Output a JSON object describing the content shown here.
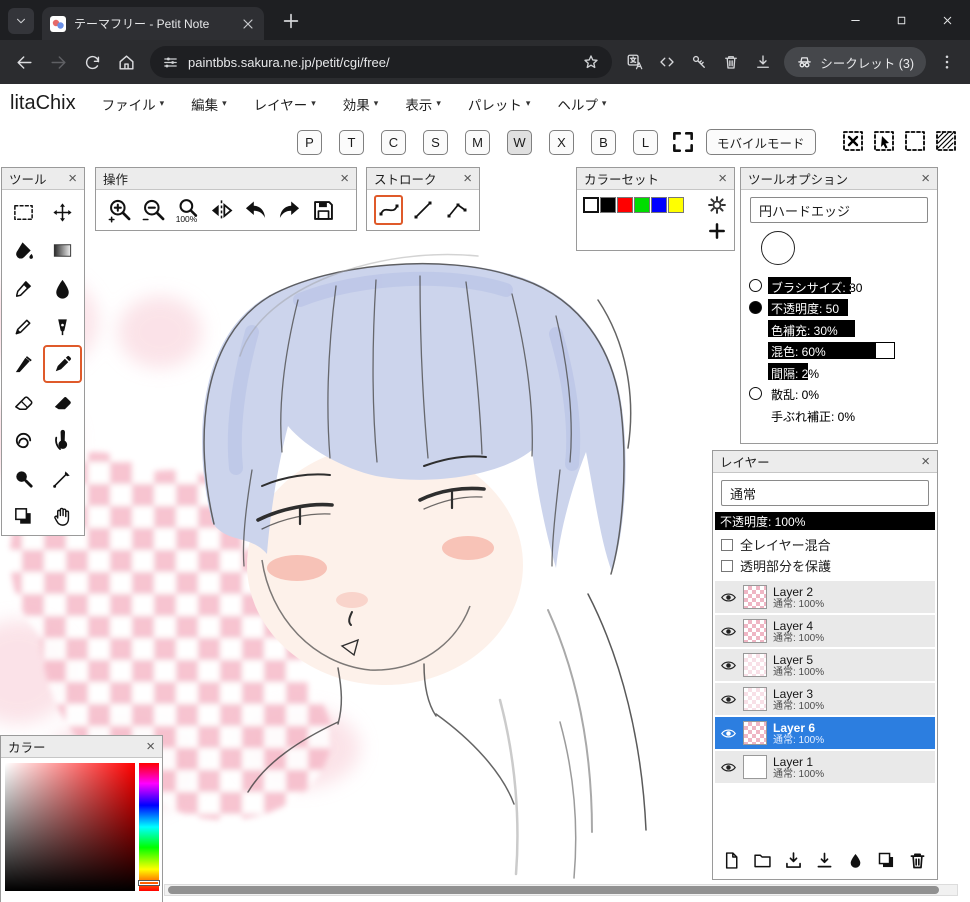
{
  "ui": {
    "close_glyph": "×",
    "caret_glyph": "▾"
  },
  "browser": {
    "tab_title": "テーマフリー - Petit Note",
    "url": "paintbbs.sakura.ne.jp/petit/cgi/free/",
    "incognito_label": "シークレット (3)"
  },
  "app": {
    "title": "litaChix",
    "menus": [
      {
        "id": "file",
        "label": "ファイル"
      },
      {
        "id": "edit",
        "label": "編集"
      },
      {
        "id": "layer",
        "label": "レイヤー"
      },
      {
        "id": "effect",
        "label": "効果"
      },
      {
        "id": "view",
        "label": "表示"
      },
      {
        "id": "palette",
        "label": "パレット"
      },
      {
        "id": "help",
        "label": "ヘルプ"
      }
    ],
    "quick_buttons": [
      {
        "label": "P"
      },
      {
        "label": "T"
      },
      {
        "label": "C"
      },
      {
        "label": "S"
      },
      {
        "label": "M"
      },
      {
        "label": "W",
        "active": true
      },
      {
        "label": "X"
      },
      {
        "label": "B"
      },
      {
        "label": "L"
      }
    ],
    "mobile_mode_label": "モバイルモード",
    "selection_buttons": [
      {
        "icon": "deselect-icon"
      },
      {
        "icon": "select-move-icon"
      },
      {
        "icon": "select-all-icon"
      },
      {
        "icon": "select-invert-icon"
      }
    ]
  },
  "panels": {
    "tools": {
      "title": "ツール",
      "items": [
        {
          "icon": "rect-select-icon"
        },
        {
          "icon": "move-icon"
        },
        {
          "icon": "fill-bucket-icon"
        },
        {
          "icon": "gradient-icon"
        },
        {
          "icon": "eyedropper-icon"
        },
        {
          "icon": "water-drop-icon"
        },
        {
          "icon": "pencil-icon"
        },
        {
          "icon": "pen-nib-icon"
        },
        {
          "icon": "knife-icon"
        },
        {
          "icon": "marker-icon",
          "selected": true
        },
        {
          "icon": "eraser-icon"
        },
        {
          "icon": "eraser-solid-icon"
        },
        {
          "icon": "smudge-icon"
        },
        {
          "icon": "finger-paint-icon"
        },
        {
          "icon": "zoom-dark-icon"
        },
        {
          "icon": "line-pen-icon"
        },
        {
          "icon": "stamp-icon"
        },
        {
          "icon": "hand-icon"
        }
      ]
    },
    "operations": {
      "title": "操作",
      "items": [
        {
          "icon": "zoom-in-icon"
        },
        {
          "icon": "zoom-out-icon"
        },
        {
          "icon": "zoom-100-icon"
        },
        {
          "icon": "flip-horizontal-icon"
        },
        {
          "icon": "undo-icon"
        },
        {
          "icon": "redo-icon"
        },
        {
          "icon": "save-icon"
        }
      ]
    },
    "stroke": {
      "title": "ストローク",
      "items": [
        {
          "icon": "curve-icon",
          "selected": true
        },
        {
          "icon": "straight-line-icon"
        },
        {
          "icon": "polyline-icon"
        }
      ]
    },
    "colorset": {
      "title": "カラーセット",
      "swatches": [
        {
          "color": "#ffffff",
          "selected": true
        },
        {
          "color": "#000000"
        },
        {
          "color": "#ff0000"
        },
        {
          "color": "#00dd00"
        },
        {
          "color": "#0000ff"
        },
        {
          "color": "#ffff00"
        }
      ]
    },
    "tool_options": {
      "title": "ツールオプション",
      "brush_type": "円ハードエッジ",
      "sliders": [
        {
          "label": "ブラシサイズ: 30",
          "fill": 52,
          "radio": "empty"
        },
        {
          "label": "不透明度: 50",
          "fill": 50,
          "radio": "filled"
        },
        {
          "label": "色補充: 30%",
          "fill": 55,
          "indent": true
        },
        {
          "label": "混色: 60%",
          "fill": 68,
          "indent": true,
          "track": 80
        },
        {
          "label": "間隔: 2%",
          "fill": 25,
          "indent": true
        },
        {
          "label": "散乱: 0%",
          "fill": 0,
          "radio": "empty"
        },
        {
          "label": "手ぶれ補正: 0%",
          "fill": 0,
          "indent": true
        }
      ]
    },
    "layers": {
      "title": "レイヤー",
      "blend_mode": "通常",
      "opacity_label": "不透明度: 100%",
      "options": [
        "全レイヤー混合",
        "透明部分を保護"
      ],
      "items": [
        {
          "name": "Layer 2",
          "info": "通常: 100%",
          "thumb": "checker"
        },
        {
          "name": "Layer 4",
          "info": "通常: 100%",
          "thumb": "checker"
        },
        {
          "name": "Layer 5",
          "info": "通常: 100%",
          "thumb": "light"
        },
        {
          "name": "Layer 3",
          "info": "通常: 100%",
          "thumb": "light"
        },
        {
          "name": "Layer 6",
          "info": "通常: 100%",
          "thumb": "checker",
          "selected": true
        },
        {
          "name": "Layer 1",
          "info": "通常: 100%",
          "thumb": "white"
        }
      ],
      "toolbar": [
        {
          "icon": "new-layer-icon"
        },
        {
          "icon": "new-folder-icon"
        },
        {
          "icon": "import-layer-icon"
        },
        {
          "icon": "export-layer-icon"
        },
        {
          "icon": "merge-layer-icon"
        },
        {
          "icon": "duplicate-layer-icon"
        },
        {
          "icon": "delete-layer-icon"
        }
      ]
    },
    "color": {
      "title": "カラー"
    }
  }
}
